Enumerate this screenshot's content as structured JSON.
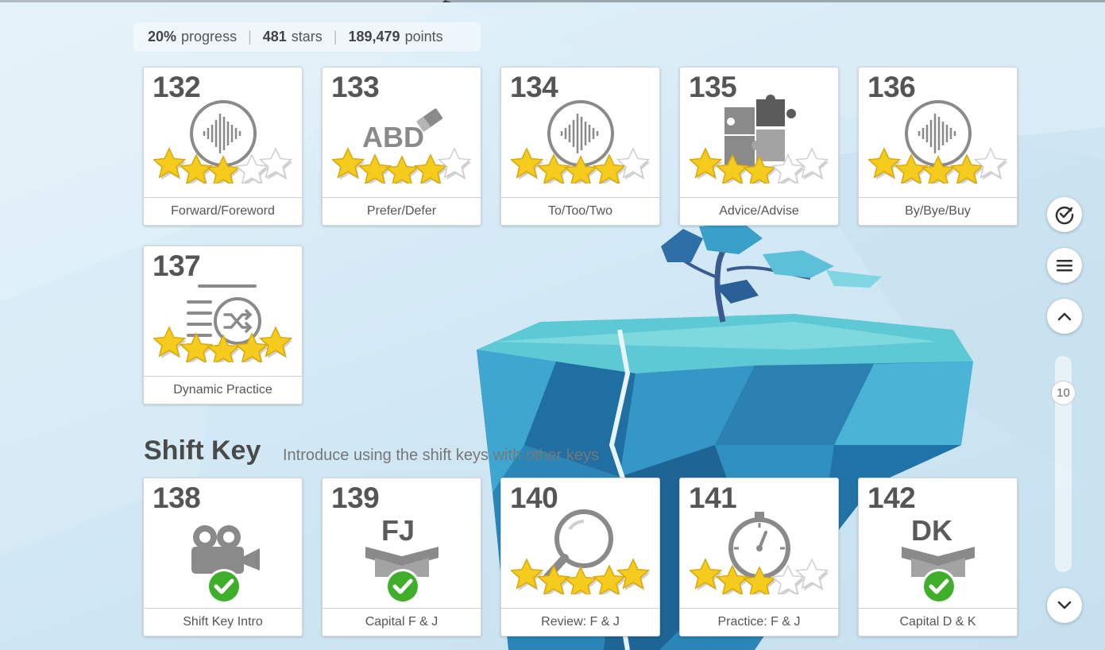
{
  "stats": {
    "progress_value": "20%",
    "progress_label": "progress",
    "stars_value": "481",
    "stars_label": "stars",
    "points_value": "189,479",
    "points_label": "points"
  },
  "lessons": [
    {
      "number": "132",
      "label": "Forward/Foreword",
      "icon": "audio-wave-icon",
      "stars": 3
    },
    {
      "number": "133",
      "label": "Prefer/Defer",
      "icon": "eraser-abc-icon",
      "icon_text": "ABD",
      "stars": 4
    },
    {
      "number": "134",
      "label": "To/Too/Two",
      "icon": "audio-wave-icon",
      "stars": 4
    },
    {
      "number": "135",
      "label": "Advice/Advise",
      "icon": "puzzle-icon",
      "stars": 3
    },
    {
      "number": "136",
      "label": "By/Bye/Buy",
      "icon": "audio-wave-icon",
      "stars": 4
    },
    {
      "number": "137",
      "label": "Dynamic Practice",
      "icon": "shuffle-list-icon",
      "stars": 5
    }
  ],
  "section": {
    "title": "Shift Key",
    "subtitle": "Introduce using the shift keys with other keys"
  },
  "shift_lessons": [
    {
      "number": "138",
      "label": "Shift Key Intro",
      "icon": "video-camera-icon",
      "completed": true
    },
    {
      "number": "139",
      "label": "Capital F & J",
      "icon": "box-icon",
      "icon_text": "FJ",
      "completed": true
    },
    {
      "number": "140",
      "label": "Review: F & J",
      "icon": "magnifier-icon",
      "stars": 5
    },
    {
      "number": "141",
      "label": "Practice: F & J",
      "icon": "stopwatch-icon",
      "stars": 3
    },
    {
      "number": "142",
      "label": "Capital D & K",
      "icon": "box-icon",
      "icon_text": "DK",
      "completed": true
    }
  ],
  "sidebar": {
    "check_icon": "check-circle-icon",
    "menu_icon": "hamburger-icon",
    "up_icon": "chevron-up-icon",
    "down_icon": "chevron-down-icon",
    "scroll_value": "10"
  },
  "colors": {
    "star_fill": "#f5cc1d",
    "check_green": "#3fae2a",
    "icon_gray": "#8a8a8a"
  }
}
